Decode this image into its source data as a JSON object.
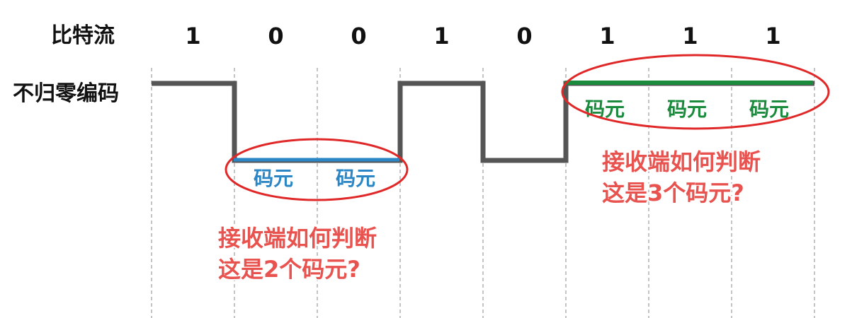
{
  "labels": {
    "bitstream": "比特流",
    "encoding": "不归零编码"
  },
  "bits": [
    "1",
    "0",
    "0",
    "1",
    "0",
    "1",
    "1",
    "1"
  ],
  "symbol_label": "码元",
  "question_left": {
    "line1": "接收端如何判断",
    "line2": "这是2个码元?"
  },
  "question_right": {
    "line1": "接收端如何判断",
    "line2": "这是3个码元?"
  },
  "colors": {
    "signal": "#555555",
    "blue_highlight": "#2a86c4",
    "green_highlight": "#1a8a3c",
    "ellipse": "#e02828",
    "question_text": "#e8534f"
  }
}
